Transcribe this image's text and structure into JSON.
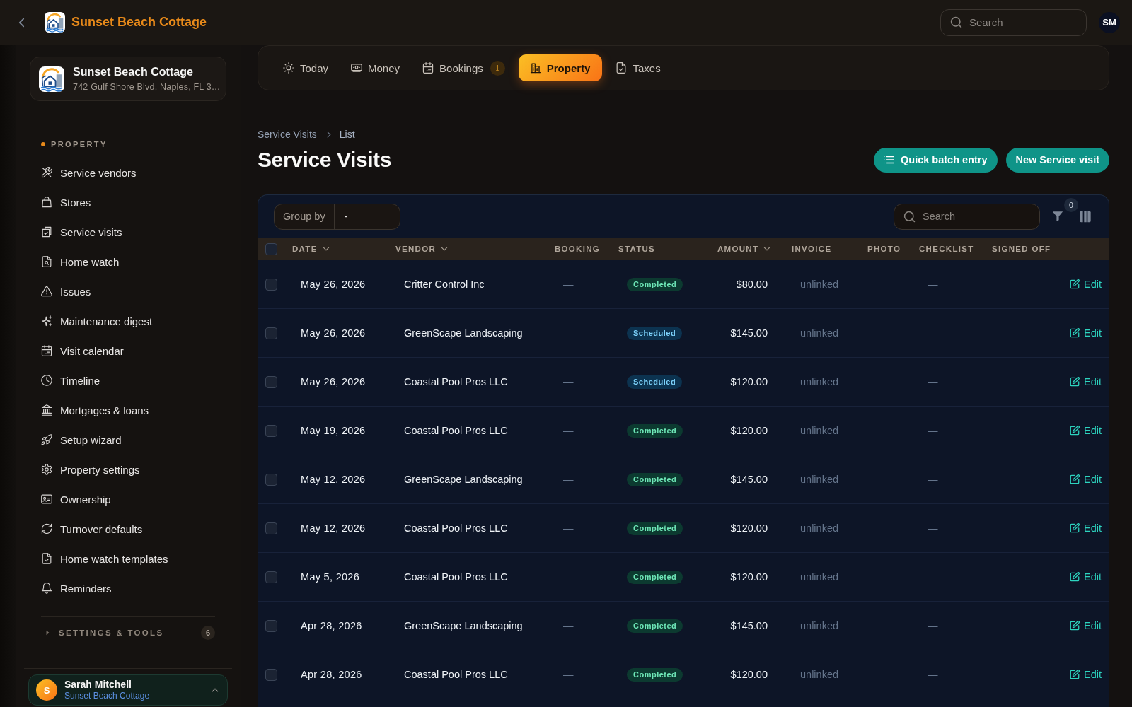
{
  "header": {
    "title": "Sunset Beach Cottage",
    "search": {
      "placeholder": "Search"
    },
    "avatar": "SM"
  },
  "sidebar": {
    "property_card": {
      "name": "Sunset Beach Cottage",
      "address": "742 Gulf Shore Blvd, Naples, FL 3…"
    },
    "section": "PROPERTY",
    "items": [
      {
        "label": "Service vendors",
        "selected": false
      },
      {
        "label": "Stores",
        "selected": false
      },
      {
        "label": "Service visits",
        "selected": false
      },
      {
        "label": "Home watch",
        "selected": false
      },
      {
        "label": "Issues",
        "selected": false
      },
      {
        "label": "Maintenance digest",
        "selected": false
      },
      {
        "label": "Visit calendar",
        "selected": false
      },
      {
        "label": "Timeline",
        "selected": false
      },
      {
        "label": "Mortgages & loans",
        "selected": false
      },
      {
        "label": "Setup wizard",
        "selected": false
      },
      {
        "label": "Property settings",
        "selected": false
      },
      {
        "label": "Ownership",
        "selected": false
      },
      {
        "label": "Turnover defaults",
        "selected": false
      },
      {
        "label": "Home watch templates",
        "selected": false
      },
      {
        "label": "Reminders",
        "selected": false
      }
    ],
    "settings_group": {
      "label": "SETTINGS & TOOLS",
      "count": "6",
      "expanded": false
    },
    "user": {
      "initial": "S",
      "name": "Sarah Mitchell",
      "subtitle": "Sunset Beach Cottage"
    }
  },
  "tabs": [
    {
      "label": "Today",
      "selected": false
    },
    {
      "label": "Money",
      "selected": false
    },
    {
      "label": "Bookings",
      "badge": "1",
      "selected": false
    },
    {
      "label": "Property",
      "selected": true
    },
    {
      "label": "Taxes",
      "selected": false
    }
  ],
  "breadcrumb": [
    "Service Visits",
    "List"
  ],
  "page_title": "Service Visits",
  "actions": [
    {
      "label": "Quick batch entry",
      "kind": "batch"
    },
    {
      "label": "New Service visit",
      "kind": "new"
    }
  ],
  "table": {
    "group_by": {
      "label": "Group by",
      "value": "-"
    },
    "search": {
      "placeholder": "Search"
    },
    "filter_count": "0",
    "select_all_checked": false,
    "columns": [
      {
        "label": "DATE",
        "sortable": true
      },
      {
        "label": "VENDOR",
        "sortable": true
      },
      {
        "label": "BOOKING",
        "sortable": false
      },
      {
        "label": "STATUS",
        "sortable": false
      },
      {
        "label": "AMOUNT",
        "sortable": true
      },
      {
        "label": "INVOICE",
        "sortable": false
      },
      {
        "label": "PHOTO",
        "sortable": false
      },
      {
        "label": "CHECKLIST",
        "sortable": false
      },
      {
        "label": "SIGNED OFF",
        "sortable": false
      }
    ],
    "rows": [
      {
        "checked": false,
        "date": "May 26, 2026",
        "vendor": "Critter Control Inc",
        "booking": "—",
        "status": {
          "label": "Completed",
          "kind": "completed"
        },
        "amount": "$80.00",
        "invoice": "unlinked",
        "checklist": "—",
        "action": "Edit"
      },
      {
        "checked": false,
        "date": "May 26, 2026",
        "vendor": "GreenScape Landscaping",
        "booking": "—",
        "status": {
          "label": "Scheduled",
          "kind": "scheduled"
        },
        "amount": "$145.00",
        "invoice": "unlinked",
        "checklist": "—",
        "action": "Edit"
      },
      {
        "checked": false,
        "date": "May 26, 2026",
        "vendor": "Coastal Pool Pros LLC",
        "booking": "—",
        "status": {
          "label": "Scheduled",
          "kind": "scheduled"
        },
        "amount": "$120.00",
        "invoice": "unlinked",
        "checklist": "—",
        "action": "Edit"
      },
      {
        "checked": false,
        "date": "May 19, 2026",
        "vendor": "Coastal Pool Pros LLC",
        "booking": "—",
        "status": {
          "label": "Completed",
          "kind": "completed"
        },
        "amount": "$120.00",
        "invoice": "unlinked",
        "checklist": "—",
        "action": "Edit"
      },
      {
        "checked": false,
        "date": "May 12, 2026",
        "vendor": "GreenScape Landscaping",
        "booking": "—",
        "status": {
          "label": "Completed",
          "kind": "completed"
        },
        "amount": "$145.00",
        "invoice": "unlinked",
        "checklist": "—",
        "action": "Edit"
      },
      {
        "checked": false,
        "date": "May 12, 2026",
        "vendor": "Coastal Pool Pros LLC",
        "booking": "—",
        "status": {
          "label": "Completed",
          "kind": "completed"
        },
        "amount": "$120.00",
        "invoice": "unlinked",
        "checklist": "—",
        "action": "Edit"
      },
      {
        "checked": false,
        "date": "May 5, 2026",
        "vendor": "Coastal Pool Pros LLC",
        "booking": "—",
        "status": {
          "label": "Completed",
          "kind": "completed"
        },
        "amount": "$120.00",
        "invoice": "unlinked",
        "checklist": "—",
        "action": "Edit"
      },
      {
        "checked": false,
        "date": "Apr 28, 2026",
        "vendor": "GreenScape Landscaping",
        "booking": "—",
        "status": {
          "label": "Completed",
          "kind": "completed"
        },
        "amount": "$145.00",
        "invoice": "unlinked",
        "checklist": "—",
        "action": "Edit"
      },
      {
        "checked": false,
        "date": "Apr 28, 2026",
        "vendor": "Coastal Pool Pros LLC",
        "booking": "—",
        "status": {
          "label": "Completed",
          "kind": "completed"
        },
        "amount": "$120.00",
        "invoice": "unlinked",
        "checklist": "—",
        "action": "Edit"
      }
    ]
  }
}
